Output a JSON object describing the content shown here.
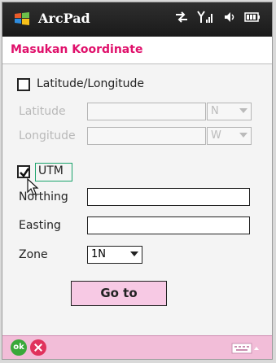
{
  "titlebar": {
    "app_name": "ArcPad"
  },
  "header": {
    "title": "Masukan Koordinate"
  },
  "latlon": {
    "checkbox_label": "Latitude/Longitude",
    "latitude_label": "Latitude",
    "latitude_value": "",
    "latitude_dir": "N",
    "longitude_label": "Longitude",
    "longitude_value": "",
    "longitude_dir": "W",
    "checked": false
  },
  "utm": {
    "checkbox_label": "UTM",
    "checked": true,
    "northing_label": "Northing",
    "northing_value": "",
    "easting_label": "Easting",
    "easting_value": "",
    "zone_label": "Zone",
    "zone_value": "1N"
  },
  "actions": {
    "goto_label": "Go to",
    "ok_label": "ok"
  },
  "colors": {
    "accent": "#e0106b",
    "button_bg": "#f7c9e4",
    "bottom_bar": "#f2bdd8"
  }
}
